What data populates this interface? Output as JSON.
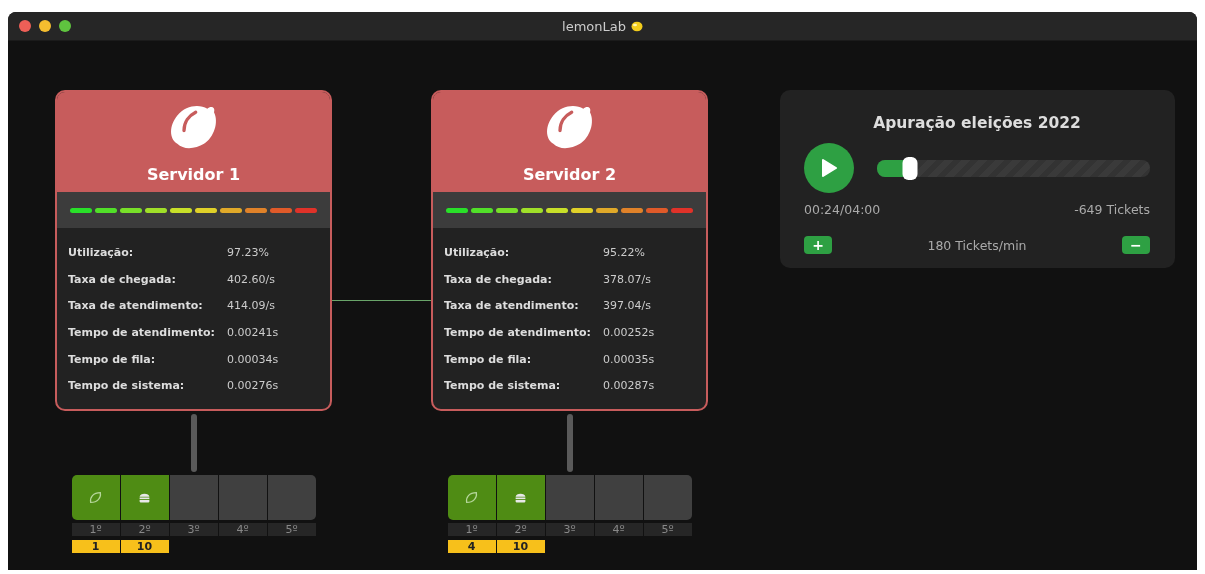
{
  "window": {
    "title": "lemonLab"
  },
  "servers": [
    {
      "name": "Servidor 1",
      "stats": [
        {
          "label": "Utilização:",
          "value": "97.23%"
        },
        {
          "label": "Taxa de chegada:",
          "value": "402.60/s"
        },
        {
          "label": "Taxa de atendimento:",
          "value": "414.09/s"
        },
        {
          "label": "Tempo de atendimento:",
          "value": "0.00241s"
        },
        {
          "label": "Tempo de fila:",
          "value": "0.00034s"
        },
        {
          "label": "Tempo de sistema:",
          "value": "0.00276s"
        }
      ],
      "queue": [
        {
          "position": "1º",
          "kind": "leaf",
          "count": "1"
        },
        {
          "position": "2º",
          "kind": "burger",
          "count": "10"
        },
        {
          "position": "3º",
          "kind": "empty"
        },
        {
          "position": "4º",
          "kind": "empty"
        },
        {
          "position": "5º",
          "kind": "empty"
        }
      ]
    },
    {
      "name": "Servidor 2",
      "stats": [
        {
          "label": "Utilização:",
          "value": "95.22%"
        },
        {
          "label": "Taxa de chegada:",
          "value": "378.07/s"
        },
        {
          "label": "Taxa de atendimento:",
          "value": "397.04/s"
        },
        {
          "label": "Tempo de atendimento:",
          "value": "0.00252s"
        },
        {
          "label": "Tempo de fila:",
          "value": "0.00035s"
        },
        {
          "label": "Tempo de sistema:",
          "value": "0.00287s"
        }
      ],
      "queue": [
        {
          "position": "1º",
          "kind": "leaf",
          "count": "4"
        },
        {
          "position": "2º",
          "kind": "burger",
          "count": "10"
        },
        {
          "position": "3º",
          "kind": "empty"
        },
        {
          "position": "4º",
          "kind": "empty"
        },
        {
          "position": "5º",
          "kind": "empty"
        }
      ]
    }
  ],
  "player": {
    "title": "Apuração eleições 2022",
    "level": 0.12,
    "elapsed": "00:24/04:00",
    "tickets": "-649 Tickets",
    "increase": "+",
    "rate": "180 Tickets/min",
    "decrease": "−"
  }
}
